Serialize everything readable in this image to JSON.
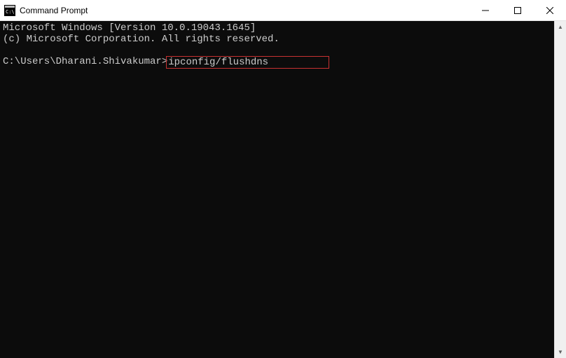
{
  "window": {
    "title": "Command Prompt"
  },
  "terminal": {
    "line1": "Microsoft Windows [Version 10.0.19043.1645]",
    "line2": "(c) Microsoft Corporation. All rights reserved.",
    "prompt": "C:\\Users\\Dharani.Shivakumar>",
    "command": "ipconfig/flushdns"
  }
}
